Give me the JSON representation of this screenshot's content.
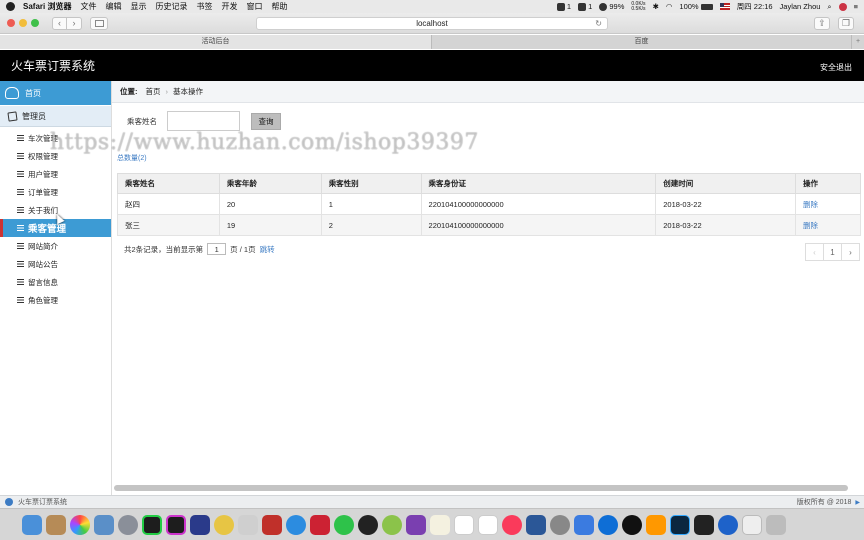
{
  "menubar": {
    "app_name": "Safari 浏览器",
    "items": [
      "文件",
      "编辑",
      "显示",
      "历史记录",
      "书签",
      "开发",
      "窗口",
      "帮助"
    ],
    "qq_count": "1",
    "wechat_count": "1",
    "battery_stat": "99%",
    "net_up": "0.0K/s",
    "net_down": "0.5K/s",
    "battery": "100%",
    "clock": "周四 22:16",
    "user": "Jaylan Zhou"
  },
  "browser": {
    "url": "localhost",
    "tabs": [
      {
        "label": "活动后台",
        "active": true
      },
      {
        "label": "百度",
        "active": false
      }
    ],
    "new_tab": "+"
  },
  "header": {
    "title": "火车票订票系统",
    "logout": "安全退出"
  },
  "sidebar": {
    "home": "首页",
    "group": "管理员",
    "items": [
      {
        "label": "车次管理"
      },
      {
        "label": "权限管理"
      },
      {
        "label": "用户管理"
      },
      {
        "label": "订单管理"
      },
      {
        "label": "关于我们"
      },
      {
        "label": "乘客管理",
        "active": true
      },
      {
        "label": "网站简介"
      },
      {
        "label": "网站公告"
      },
      {
        "label": "留言信息"
      },
      {
        "label": "角色管理"
      }
    ]
  },
  "breadcrumb": {
    "label": "位置:",
    "home": "首页",
    "current": "基本操作"
  },
  "search": {
    "label": "乘客姓名",
    "value": "",
    "button": "查询"
  },
  "total": "总数量(2)",
  "table": {
    "headers": [
      "乘客姓名",
      "乘客年龄",
      "乘客性别",
      "乘客身份证",
      "创建时间",
      "操作"
    ],
    "rows": [
      [
        "赵四",
        "20",
        "1",
        "220104100000000000",
        "2018-03-22",
        "删除"
      ],
      [
        "张三",
        "19",
        "2",
        "220104100000000000",
        "2018-03-22",
        "删除"
      ]
    ]
  },
  "pagination": {
    "summary": "共2条记录，当前显示第",
    "page_input": "1",
    "page_of": "页 / 1页",
    "jump": "跳转",
    "prev": "‹",
    "current": "1",
    "next": "›"
  },
  "footer": {
    "left": "火车票订票系统",
    "right": "版权所有 @ 2018"
  },
  "watermark": "https://www.huzhan.com/ishop39397",
  "colors": {
    "accent": "#3d9bd4",
    "header_bg": "#000000",
    "link": "#3d7cc4",
    "active_marker": "#cc3333"
  },
  "dock_apps": [
    "finder-icon",
    "notes-icon",
    "photos-icon",
    "preview-icon",
    "launchpad-icon",
    "pycharm-icon",
    "intellij-icon",
    "xcode-icon",
    "sequel-icon",
    "archive-icon",
    "redis-icon",
    "safari-icon",
    "parallels-icon",
    "wechat-icon",
    "qq-icon",
    "app-icon",
    "rp-icon",
    "textedit-icon",
    "preview2-icon",
    "calendar-icon",
    "music-icon",
    "word-icon",
    "system-prefs-icon",
    "baidu-netdisk-icon",
    "teamviewer-icon",
    "qq2-icon",
    "sublime-icon",
    "photoshop-icon",
    "terminal-icon",
    "browser-icon",
    "itunes-icon",
    "trash-icon"
  ]
}
